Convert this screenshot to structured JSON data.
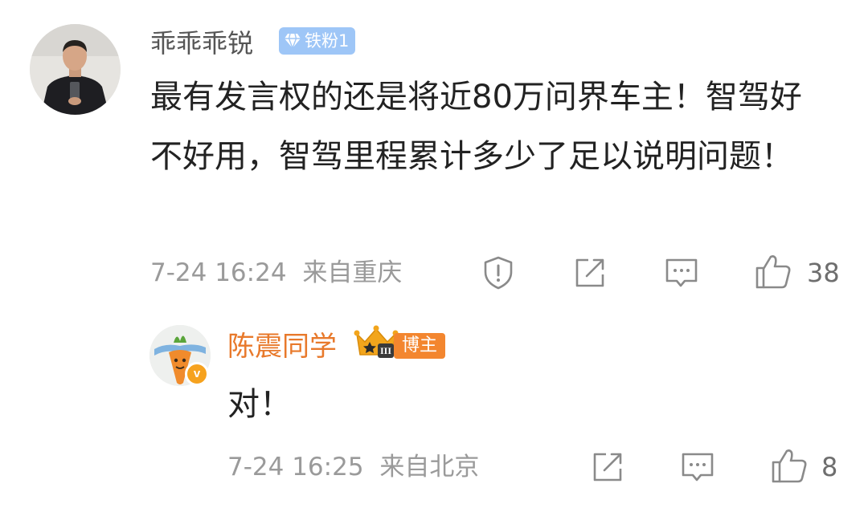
{
  "comment": {
    "user_name": "乖乖乖锐",
    "fan_badge": "铁粉1",
    "text": "最有发言权的还是将近80万问界车主！智驾好不好用，智驾里程累计多少了足以说明问题！",
    "time": "7-24 16:24",
    "location": "来自重庆",
    "like_count": "38",
    "icons": [
      "report-icon",
      "share-icon",
      "comment-icon",
      "like-icon"
    ]
  },
  "reply": {
    "user_name": "陈震同学",
    "crown_level": "III",
    "verified_badge": "v",
    "host_badge": "博主",
    "text": "对！",
    "time": "7-24 16:25",
    "location": "来自北京",
    "like_count": "8",
    "icons": [
      "share-icon",
      "comment-icon",
      "like-icon"
    ]
  },
  "colors": {
    "reply_name": "#e8792b",
    "host_badge": "#f3862f",
    "fan_badge": "#9ec6f7",
    "meta_text": "#9a9a9a",
    "body_text": "#222222"
  }
}
